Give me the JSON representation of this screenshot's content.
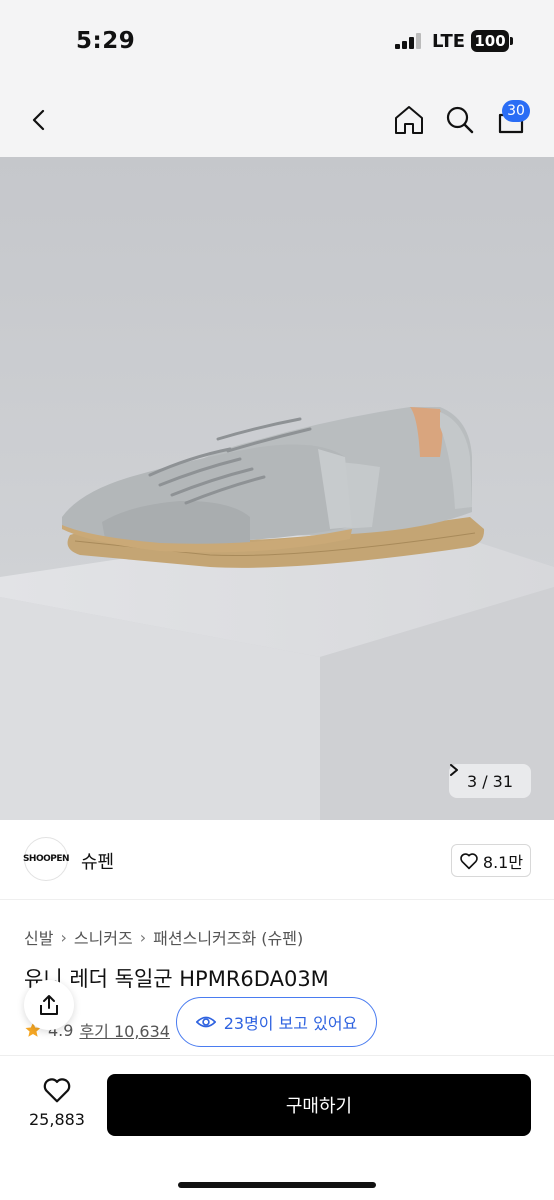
{
  "status_bar": {
    "time": "5:29",
    "network": "LTE",
    "battery": "100"
  },
  "nav": {
    "cart_count": "30"
  },
  "gallery": {
    "counter": "3 / 31"
  },
  "brand": {
    "logo_text": "SHOOPEN",
    "name": "슈펜",
    "likes": "8.1만"
  },
  "breadcrumb": [
    "신발",
    "스니커즈",
    "패션스니커즈화 (슈펜)"
  ],
  "product": {
    "title": "유니 레더 독일군 HPMR6DA03M",
    "rating": "4.9",
    "reviews": "후기 10,634"
  },
  "viewing": {
    "text": "23명이 보고 있어요"
  },
  "bottom": {
    "wish_count": "25,883",
    "buy_label": "구매하기"
  },
  "colors": {
    "accent": "#2a6df5",
    "buy_button": "#000000",
    "star": "#f5a623"
  }
}
